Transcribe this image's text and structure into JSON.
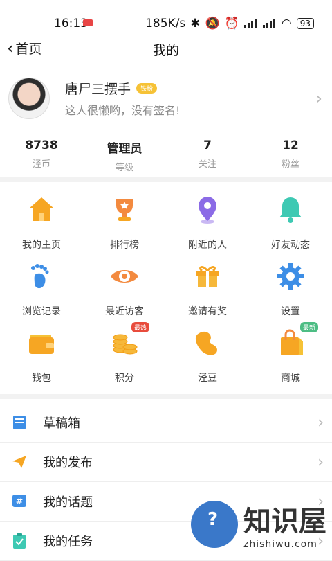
{
  "status": {
    "time": "16:13",
    "network_speed": "185K/s",
    "battery": "93"
  },
  "nav": {
    "back_label": "首页",
    "title": "我的"
  },
  "profile": {
    "username": "唐尸三摆手",
    "badge": "铁粉",
    "signature": "这人很懒哟，没有签名!"
  },
  "stats": [
    {
      "value": "8738",
      "label": "泾币"
    },
    {
      "value": "管理员",
      "label": "等级"
    },
    {
      "value": "7",
      "label": "关注"
    },
    {
      "value": "12",
      "label": "粉丝"
    }
  ],
  "grid": [
    {
      "label": "我的主页",
      "icon": "home-icon"
    },
    {
      "label": "排行榜",
      "icon": "trophy-icon"
    },
    {
      "label": "附近的人",
      "icon": "location-pin-icon"
    },
    {
      "label": "好友动态",
      "icon": "bell-icon"
    },
    {
      "label": "浏览记录",
      "icon": "footprint-icon"
    },
    {
      "label": "最近访客",
      "icon": "eye-icon"
    },
    {
      "label": "邀请有奖",
      "icon": "gift-icon"
    },
    {
      "label": "设置",
      "icon": "gear-icon"
    },
    {
      "label": "钱包",
      "icon": "wallet-icon"
    },
    {
      "label": "积分",
      "icon": "coins-icon",
      "tag": "最热"
    },
    {
      "label": "泾豆",
      "icon": "bean-icon"
    },
    {
      "label": "商城",
      "icon": "shopping-bag-icon",
      "tag": "最新"
    }
  ],
  "list": [
    {
      "label": "草稿箱",
      "icon": "drafts-icon"
    },
    {
      "label": "我的发布",
      "icon": "paper-plane-icon"
    },
    {
      "label": "我的话题",
      "icon": "hashtag-icon"
    },
    {
      "label": "我的任务",
      "icon": "task-clipboard-icon"
    }
  ],
  "watermark": {
    "cn": "知识屋",
    "en": "zhishiwu.com"
  },
  "colors": {
    "accent_orange": "#f6a623",
    "blue": "#3d8ee6",
    "purple": "#8b6be6",
    "teal": "#3ec9b3"
  }
}
